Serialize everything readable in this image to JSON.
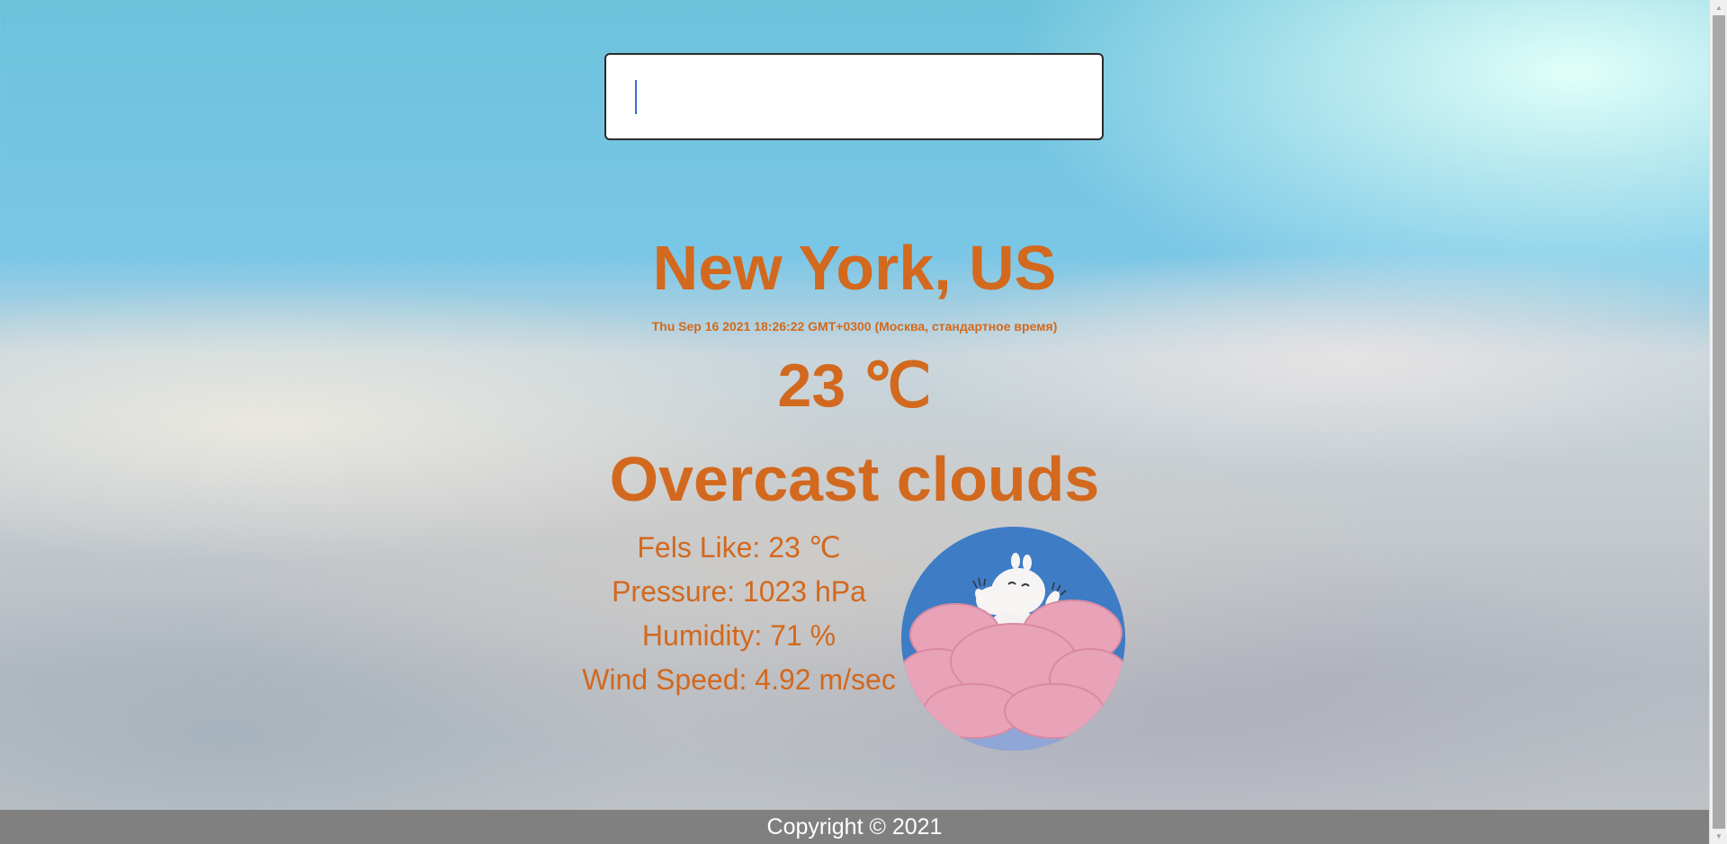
{
  "search": {
    "value": "",
    "placeholder": ""
  },
  "weather": {
    "location": "New York, US",
    "datetime": "Thu Sep 16 2021 18:26:22 GMT+0300 (Москва, стандартное время)",
    "temperature_value": "23",
    "temperature_unit": "℃",
    "condition": "Overcast clouds",
    "feels_like_label": "Fels Like: 23",
    "feels_like_unit": "℃",
    "pressure": "Pressure: 1023 hPa",
    "humidity": "Humidity: 71 %",
    "wind_speed": "Wind Speed: 4.92 m/sec"
  },
  "footer": {
    "copyright": "Copyright © 2021"
  },
  "colors": {
    "accent": "#d2691e",
    "footer_bg": "#808080",
    "footer_text": "#ffffff"
  },
  "icons": {
    "weather_image": "moomin-on-cloud-image"
  }
}
